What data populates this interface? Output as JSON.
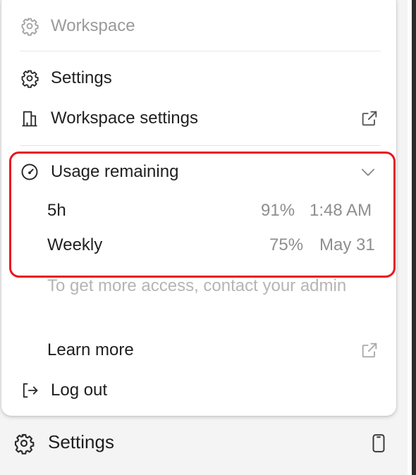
{
  "menu": {
    "workspace_header": "Workspace",
    "settings_label": "Settings",
    "workspace_settings_label": "Workspace settings",
    "usage": {
      "title": "Usage remaining",
      "rows": [
        {
          "period": "5h",
          "percent": "91%",
          "reset": "1:48 AM"
        },
        {
          "period": "Weekly",
          "percent": "75%",
          "reset": "May 31"
        }
      ]
    },
    "access_note": "To get more access, contact your admin",
    "learn_more_label": "Learn more",
    "logout_label": "Log out"
  },
  "footer": {
    "settings_label": "Settings"
  },
  "icons": {
    "workspace": "gear-icon",
    "settings": "gear-icon",
    "workspace_settings": "building-icon",
    "external": "external-link-icon",
    "usage": "gauge-icon",
    "collapse": "chevron-down-icon",
    "logout": "logout-icon",
    "device": "phone-icon"
  },
  "colors": {
    "highlight_border": "#e8171f",
    "muted_text": "#9a9a9a"
  }
}
